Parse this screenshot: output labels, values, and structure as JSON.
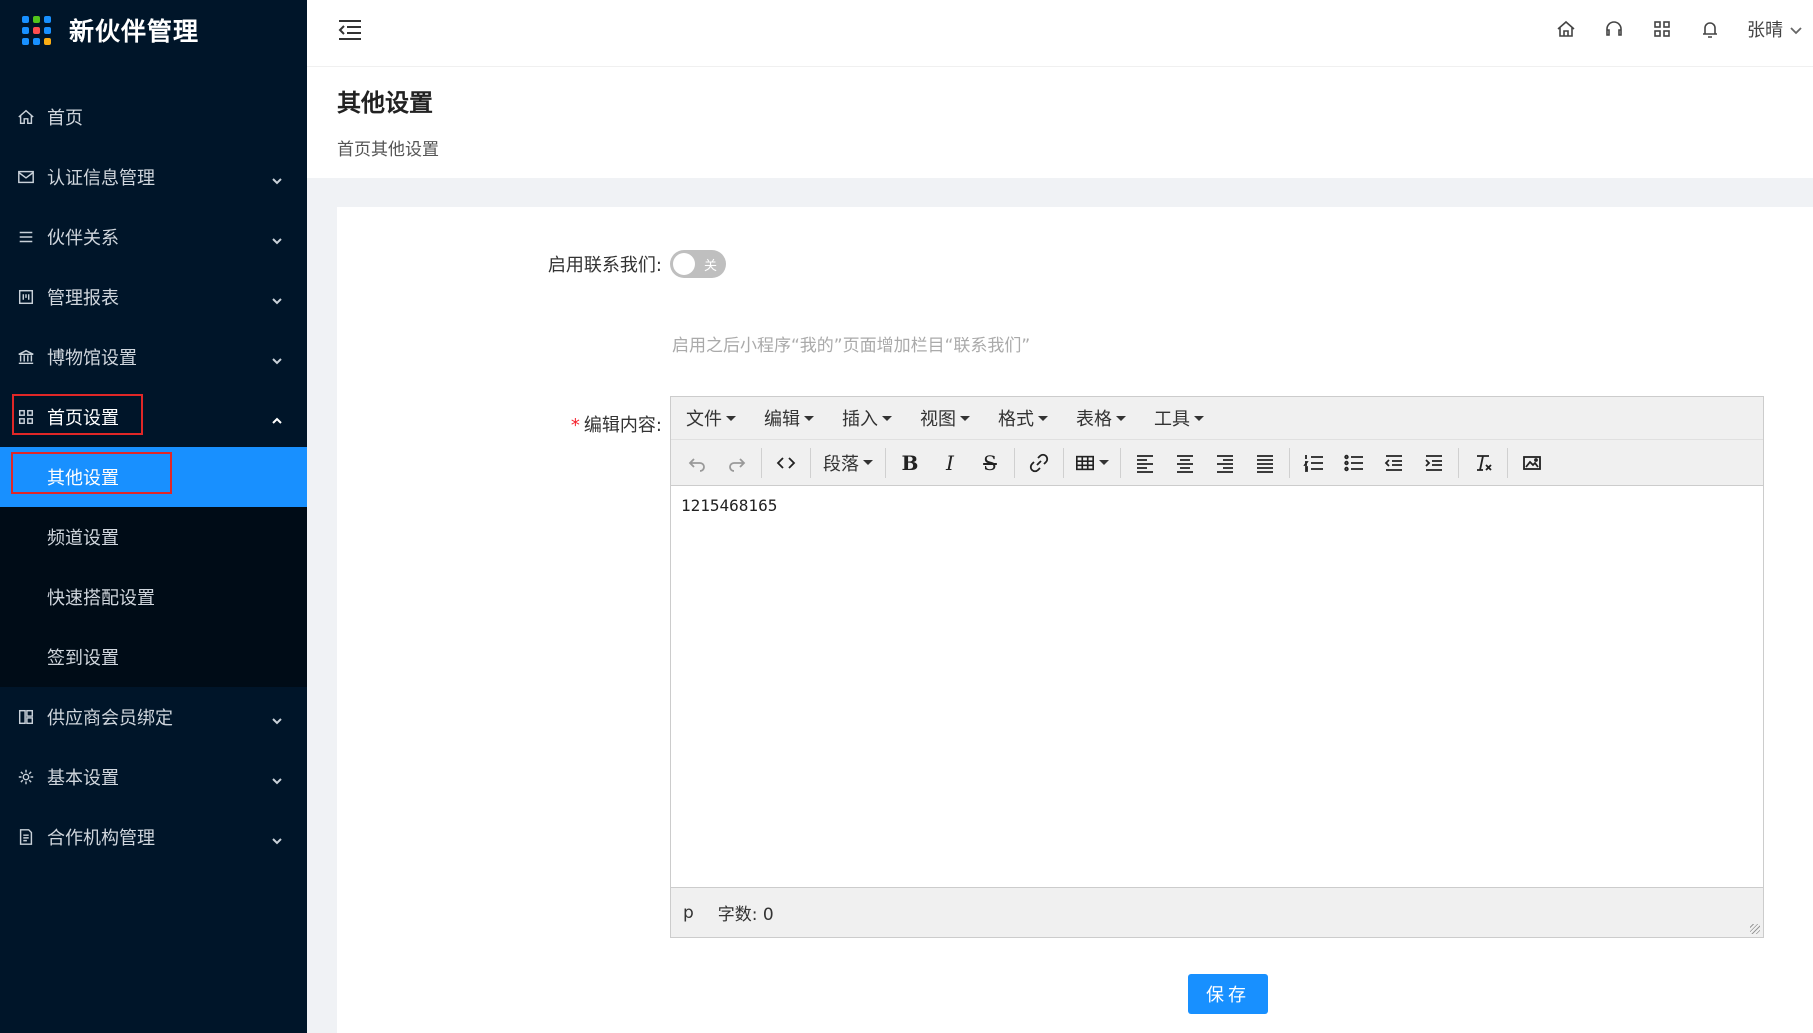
{
  "app": {
    "title": "新伙伴管理"
  },
  "sidebar": {
    "items": [
      {
        "label": "首页",
        "icon": "home-icon"
      },
      {
        "label": "认证信息管理",
        "icon": "mail-icon"
      },
      {
        "label": "伙伴关系",
        "icon": "list-icon"
      },
      {
        "label": "管理报表",
        "icon": "report-icon"
      },
      {
        "label": "博物馆设置",
        "icon": "museum-icon"
      },
      {
        "label": "首页设置",
        "icon": "grid-icon",
        "expanded": true
      },
      {
        "label": "供应商会员绑定",
        "icon": "apps-icon"
      },
      {
        "label": "基本设置",
        "icon": "gear-icon"
      },
      {
        "label": "合作机构管理",
        "icon": "document-icon"
      }
    ],
    "subitems": [
      {
        "label": "其他设置",
        "active": true
      },
      {
        "label": "频道设置"
      },
      {
        "label": "快速搭配设置"
      },
      {
        "label": "签到设置"
      }
    ]
  },
  "header": {
    "user_name": "张晴"
  },
  "page": {
    "title": "其他设置",
    "subtitle": "首页其他设置"
  },
  "form": {
    "contact_label": "启用联系我们:",
    "toggle_text": "关",
    "toggle_on": false,
    "hint": "启用之后小程序“我的”页面增加栏目“联系我们”",
    "content_label": "编辑内容:",
    "required_mark": "*",
    "save_label": "保存"
  },
  "editor": {
    "menus": [
      "文件",
      "编辑",
      "插入",
      "视图",
      "格式",
      "表格",
      "工具"
    ],
    "paragraph_label": "段落",
    "bold_glyph": "B",
    "italic_glyph": "I",
    "strike_glyph": "S",
    "content": "1215468165",
    "status_path": "p",
    "word_count": "字数: 0"
  },
  "colors": {
    "sidebar_bg": "#001529",
    "accent": "#1890ff",
    "highlight_box": "#e02727"
  }
}
